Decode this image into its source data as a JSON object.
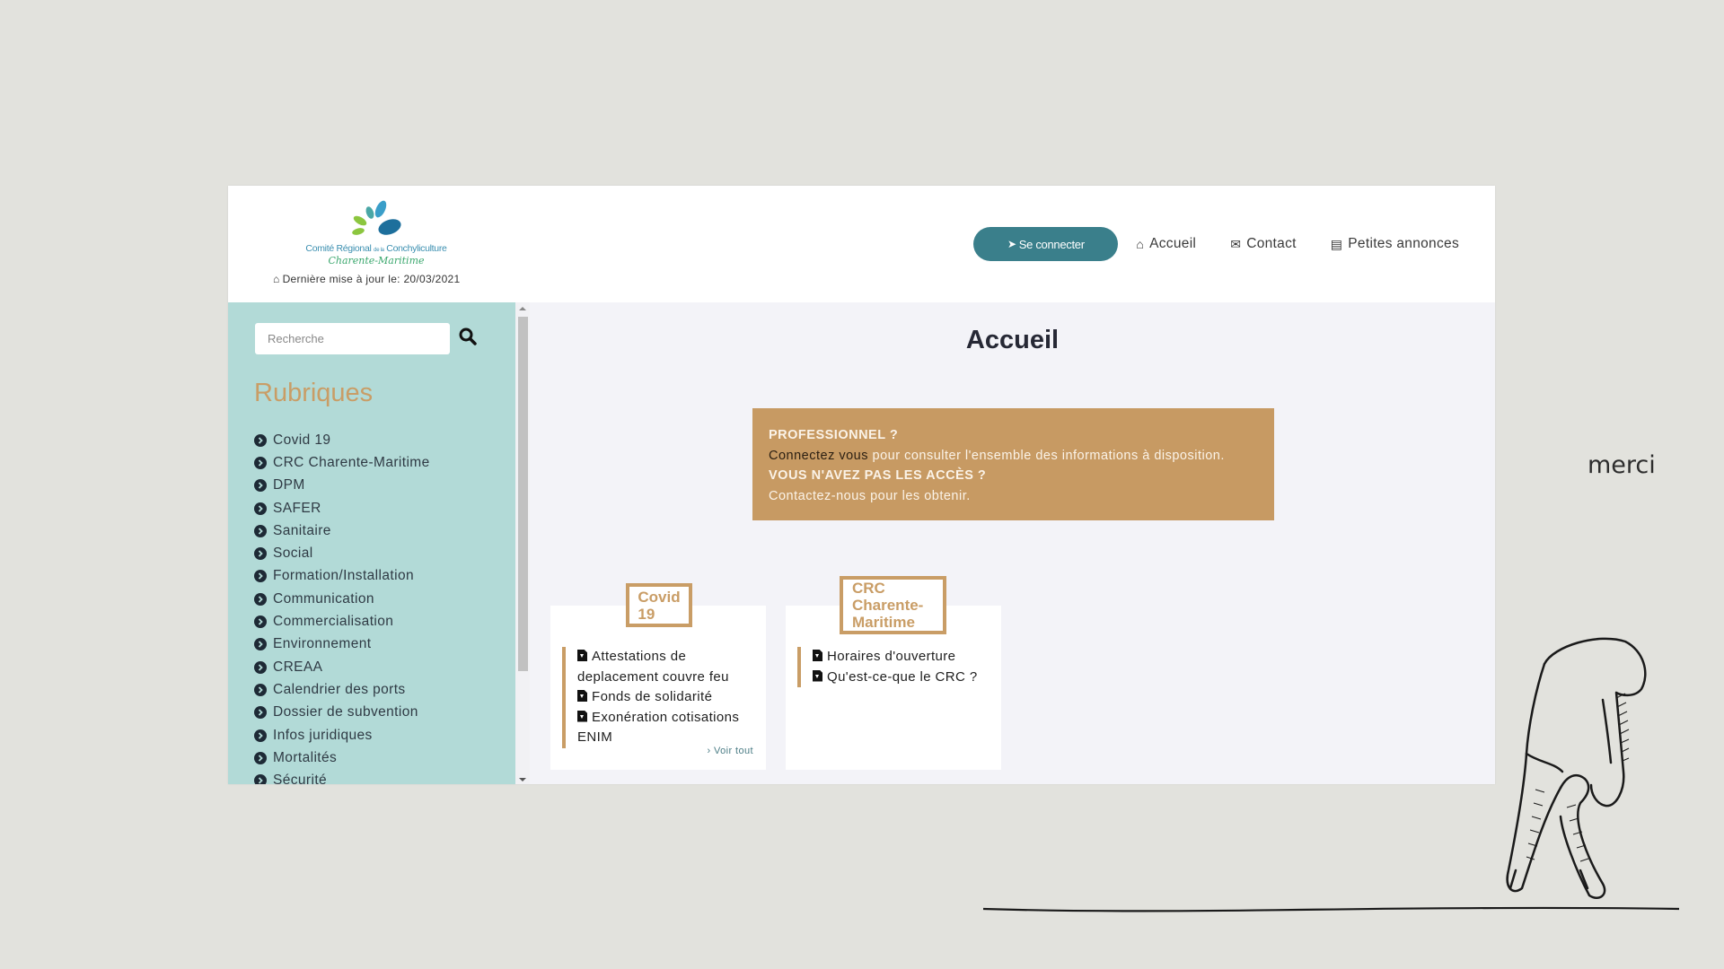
{
  "header": {
    "logo": {
      "line1_a": "Comité Régional",
      "line1_small": "de la",
      "line1_b": "Conchyliculture",
      "line2": "Charente-Maritime"
    },
    "last_update_label": "Dernière mise à jour le: 20/03/2021",
    "last_update_icon": "home-icon",
    "nav": {
      "connect_label": "Se connecter",
      "connect_icon": "sign-in-icon",
      "links": [
        {
          "label": "Accueil",
          "icon": "home-icon"
        },
        {
          "label": "Contact",
          "icon": "envelope-icon"
        },
        {
          "label": "Petites annonces",
          "icon": "newspaper-icon"
        }
      ]
    }
  },
  "sidebar": {
    "search": {
      "placeholder": "Recherche",
      "value": ""
    },
    "heading": "Rubriques",
    "items": [
      "Covid 19",
      "CRC Charente-Maritime",
      "DPM",
      "SAFER",
      "Sanitaire",
      "Social",
      "Formation/Installation",
      "Communication",
      "Commercialisation",
      "Environnement",
      "CREAA",
      "Calendrier des ports",
      "Dossier de subvention",
      "Infos juridiques",
      "Mortalités",
      "Sécurité"
    ]
  },
  "main": {
    "title": "Accueil",
    "promo": {
      "q1": "PROFESSIONNEL ?",
      "connect_link": "Connectez vous",
      "connect_rest": " pour consulter l'ensemble des informations à disposition.",
      "q2": "VOUS N'AVEZ PAS LES ACCÈS ?",
      "contact_line": "Contactez-nous pour les obtenir."
    },
    "cards": [
      {
        "title": "Covid 19",
        "items": [
          "Attestations de deplacement couvre feu",
          "Fonds de solidarité",
          "Exonération cotisations ENIM"
        ],
        "more_label": "Voir tout"
      },
      {
        "title": "CRC Charente-Maritime",
        "items": [
          "Horaires d'ouverture",
          "Qu'est-ce-que le CRC ?"
        ]
      }
    ]
  },
  "slide": {
    "caption": "merci"
  },
  "colors": {
    "accent_gold": "#c99d66",
    "promo_bg": "#c79a63",
    "sidebar_bg": "#b2dad7",
    "button_teal": "#3a7f8b",
    "slide_bg": "#e2e2dd"
  }
}
